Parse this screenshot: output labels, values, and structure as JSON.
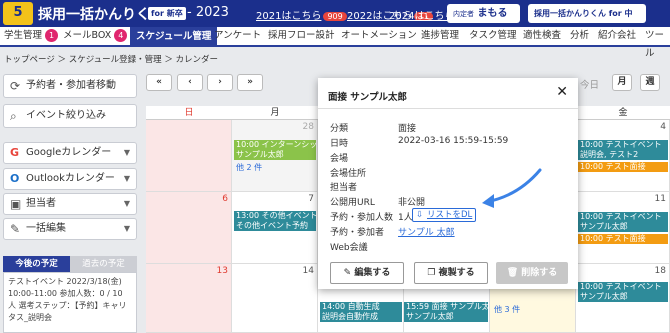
{
  "header": {
    "logo_badge": "5",
    "logo_text": "採用一括かんりくん",
    "logo_sub": "for 新卒",
    "logo_year": "- 2023",
    "year_links": [
      {
        "label": "2021はこちら",
        "count": "909"
      },
      {
        "label": "2022はこちら",
        "count": "11"
      },
      {
        "label": "2024はこちら",
        "count": ""
      }
    ],
    "btn_machine": "まもるくん",
    "btn_chuto": "採用一括かんりくん for 中途"
  },
  "nav": {
    "items": [
      {
        "label": "学生管理",
        "badge": "1"
      },
      {
        "label": "メールBOX",
        "badge": "4"
      },
      {
        "label": "スケジュール管理",
        "badge": ""
      },
      {
        "label": "アンケート",
        "badge": ""
      },
      {
        "label": "採用フロー設計",
        "badge": ""
      },
      {
        "label": "オートメーション",
        "badge": ""
      },
      {
        "label": "進捗管理",
        "badge": ""
      },
      {
        "label": "タスク管理",
        "badge": ""
      },
      {
        "label": "適性検査",
        "badge": ""
      },
      {
        "label": "分析",
        "badge": ""
      },
      {
        "label": "紹介会社",
        "badge": ""
      },
      {
        "label": "ツール",
        "badge": ""
      }
    ]
  },
  "breadcrumb": "トップページ ＞ スケジュール登録・管理 ＞ カレンダー",
  "sidebar": {
    "move_btn": "予約者・参加者移動",
    "filter_btn": "イベント絞り込み",
    "google": "Googleカレンダー",
    "outlook": "Outlookカレンダー",
    "assignee": "担当者",
    "bulk_edit": "一括編集",
    "tab_upcoming": "今後の予定",
    "tab_past": "過去の予定",
    "schedule_text": "テストイベント 2022/3/18(金) 10:00-11:00 参加人数：0 / 10 人 選考ステップ：【予約】キャリタス_説明会"
  },
  "calendar": {
    "nav_buttons": [
      "«",
      "‹",
      "›",
      "»"
    ],
    "today_label": "今日",
    "view_month": "月",
    "view_week": "週",
    "days": [
      "日",
      "月",
      "金"
    ],
    "dates": {
      "sun": [
        "",
        "6",
        "13"
      ],
      "mon": [
        "28",
        "7",
        "14"
      ],
      "fri": [
        "4",
        "11",
        "18"
      ]
    },
    "events": [
      {
        "text": "10:00 インターンシップ",
        "color": "#8bc34a"
      },
      {
        "text": "サンプル太郎",
        "color": "#8bc34a"
      },
      {
        "text": "他 2 件",
        "color": ""
      },
      {
        "text": "13:00 その他イベント取",
        "color": "#2e8b9a"
      },
      {
        "text": "その他イベント予約",
        "color": "#2e8b9a"
      },
      {
        "text": "14:00 自動生成",
        "color": "#2e8b9a"
      },
      {
        "text": "説明会自動作成",
        "color": "#2e8b9a"
      },
      {
        "text": "15:59 面接 サンプル太郎",
        "color": "#2e8b9a"
      },
      {
        "text": "サンプル太郎",
        "color": "#2e8b9a"
      },
      {
        "text": "他 3 件",
        "color": ""
      },
      {
        "text": "10:00 テストイベント",
        "color": "#2e8b9a"
      },
      {
        "text": "説明会, テスト2",
        "color": "#2e8b9a"
      },
      {
        "text": "10:00 テスト面接",
        "color": "#f39c12"
      },
      {
        "text": "10:00 テストイベント",
        "color": "#2e8b9a"
      },
      {
        "text": "サンプル太郎",
        "color": "#2e8b9a"
      },
      {
        "text": "10:00 テスト面接",
        "color": "#f39c12"
      },
      {
        "text": "10:00 テストイベント",
        "color": "#2e8b9a"
      },
      {
        "text": "サンプル太郎",
        "color": "#2e8b9a"
      }
    ]
  },
  "modal": {
    "title": "面接 サンプル太郎",
    "rows": [
      {
        "label": "分類",
        "value": "面接"
      },
      {
        "label": "日時",
        "value": "2022-03-16 15:59-15:59"
      },
      {
        "label": "会場",
        "value": ""
      },
      {
        "label": "会場住所",
        "value": ""
      },
      {
        "label": "担当者",
        "value": ""
      },
      {
        "label": "公開用URL",
        "value": "非公開"
      },
      {
        "label": "予約・参加人数",
        "value": "1人"
      },
      {
        "label": "予約・参加者",
        "value": "サンプル 太郎"
      },
      {
        "label": "Web会議",
        "value": ""
      }
    ],
    "download_btn": "リストをDL",
    "edit_btn": "編集する",
    "copy_btn": "複製する",
    "delete_btn": "削除する"
  }
}
